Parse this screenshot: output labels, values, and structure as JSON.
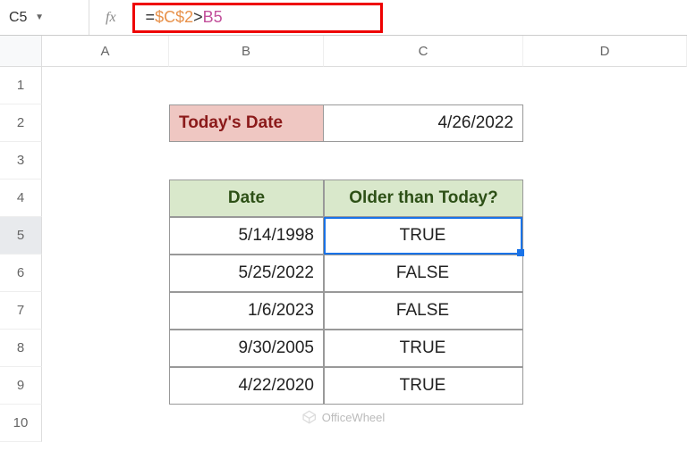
{
  "nameBox": "C5",
  "formula": {
    "eq": "=",
    "ref1": "$C$2",
    "op": ">",
    "ref2": "B5"
  },
  "columns": [
    "A",
    "B",
    "C",
    "D"
  ],
  "rows": [
    "1",
    "2",
    "3",
    "4",
    "5",
    "6",
    "7",
    "8",
    "9",
    "10"
  ],
  "todaysDateLabel": "Today's Date",
  "todaysDateValue": "4/26/2022",
  "table": {
    "headers": {
      "date": "Date",
      "older": "Older than Today?"
    },
    "data": [
      {
        "date": "5/14/1998",
        "result": "TRUE"
      },
      {
        "date": "5/25/2022",
        "result": "FALSE"
      },
      {
        "date": "1/6/2023",
        "result": "FALSE"
      },
      {
        "date": "9/30/2005",
        "result": "TRUE"
      },
      {
        "date": "4/22/2020",
        "result": "TRUE"
      }
    ]
  },
  "watermark": "OfficeWheel",
  "activeCell": {
    "row": 5,
    "col": "C"
  }
}
